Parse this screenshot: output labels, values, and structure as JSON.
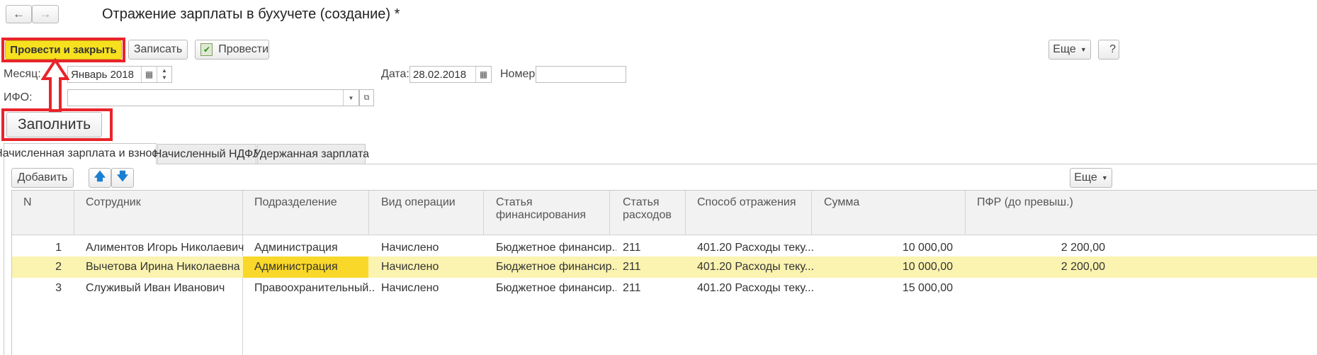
{
  "nav": {
    "back_icon": "arrow-left-icon",
    "forward_icon": "arrow-right-icon"
  },
  "window": {
    "title": "Отражение зарплаты в бухучете (создание) *"
  },
  "toolbar": {
    "post_close_label": "Провести и закрыть",
    "save_label": "Записать",
    "post_label": "Провести",
    "more_label": "Еще",
    "help_label": "?"
  },
  "form": {
    "month_label": "Месяц:",
    "month_value": "Январь 2018",
    "date_label": "Дата:",
    "date_value": "28.02.2018",
    "number_label": "Номер:",
    "number_value": "",
    "ifo_label": "ИФО:",
    "ifo_value": ""
  },
  "fill_button": {
    "label": "Заполнить"
  },
  "tabs": [
    {
      "label": "Начисленная зарплата и взносы",
      "active": true
    },
    {
      "label": "Начисленный НДФЛ",
      "active": false
    },
    {
      "label": "Удержанная зарплата",
      "active": false
    }
  ],
  "table_toolbar": {
    "add_label": "Добавить",
    "more_label": "Еще"
  },
  "table": {
    "columns": [
      "N",
      "Сотрудник",
      "Подразделение",
      "Вид операции",
      "Статья финансирования",
      "Статья расходов",
      "Способ отражения",
      "Сумма",
      "ПФР (до превыш.)"
    ],
    "rows": [
      [
        "1",
        "Алиментов Игорь Николаевич",
        "Администрация",
        "Начислено",
        "Бюджетное финансир...",
        "211",
        "401.20 Расходы теку...",
        "10 000,00",
        "2 200,00"
      ],
      [
        "2",
        "Вычетова Ирина Николаевна",
        "Администрация",
        "Начислено",
        "Бюджетное финансир...",
        "211",
        "401.20 Расходы теку...",
        "10 000,00",
        "2 200,00"
      ],
      [
        "3",
        "Служивый Иван Иванович",
        "Правоохранительный...",
        "Начислено",
        "Бюджетное финансир...",
        "211",
        "401.20 Расходы теку...",
        "15 000,00",
        ""
      ]
    ]
  },
  "colors": {
    "highlight_button": "#f7e11f",
    "selected_row": "#fbf3b0",
    "selected_cell": "#f9d829",
    "annotation": "#e8242a"
  }
}
